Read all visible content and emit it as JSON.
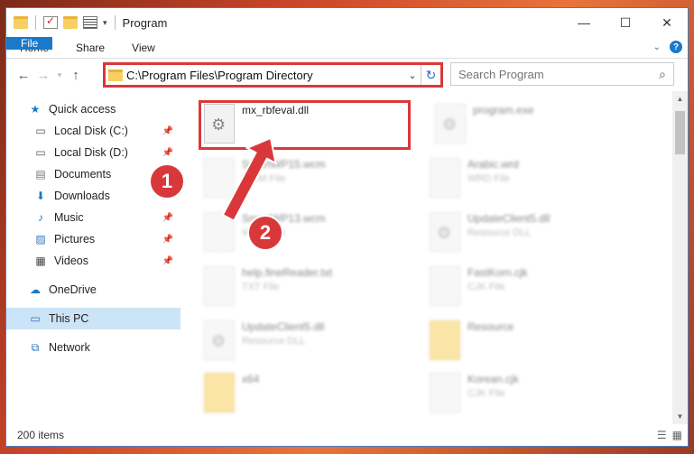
{
  "window": {
    "title": "Program"
  },
  "controls": {
    "minimize": "—",
    "maximize": "☐",
    "close": "✕"
  },
  "ribbon": {
    "tabs": [
      "File",
      "Home",
      "Share",
      "View"
    ]
  },
  "address": {
    "path": "C:\\Program Files\\Program Directory",
    "search_placeholder": "Search Program"
  },
  "sidebar": {
    "quick_access": "Quick access",
    "items": [
      {
        "label": "Local Disk (C:)",
        "icon": "drive-icon"
      },
      {
        "label": "Local Disk (D:)",
        "icon": "drive-icon"
      },
      {
        "label": "Documents",
        "icon": "documents-icon"
      },
      {
        "label": "Downloads",
        "icon": "downloads-icon"
      },
      {
        "label": "Music",
        "icon": "music-icon"
      },
      {
        "label": "Pictures",
        "icon": "pictures-icon"
      },
      {
        "label": "Videos",
        "icon": "videos-icon"
      }
    ],
    "onedrive": "OneDrive",
    "thispc": "This PC",
    "network": "Network"
  },
  "files": [
    {
      "name": "mx_rbfeval.dll",
      "type": ""
    },
    {
      "name": "program.exe",
      "type": ""
    },
    {
      "name": "SmartWP15.wcm",
      "type": "WCM File"
    },
    {
      "name": "Arabic.wrd",
      "type": "WRD File"
    },
    {
      "name": "SmartWP13.wcm",
      "type": "WCM File"
    },
    {
      "name": "UpdateClient5.dll",
      "type": "Resource DLL"
    },
    {
      "name": "help.fineReader.txt",
      "type": "TXT File"
    },
    {
      "name": "FastKorn.cjk",
      "type": "CJK File"
    },
    {
      "name": "UpdateClient5.dll",
      "type": "Resource DLL"
    },
    {
      "name": "Resource",
      "type": ""
    },
    {
      "name": "x64",
      "type": ""
    },
    {
      "name": "Korean.cjk",
      "type": "CJK File"
    }
  ],
  "annotations": {
    "step1": "1",
    "step2": "2"
  },
  "status": {
    "count": "200 items"
  },
  "colors": {
    "accent": "#1979ca",
    "highlight": "#d9383a"
  }
}
